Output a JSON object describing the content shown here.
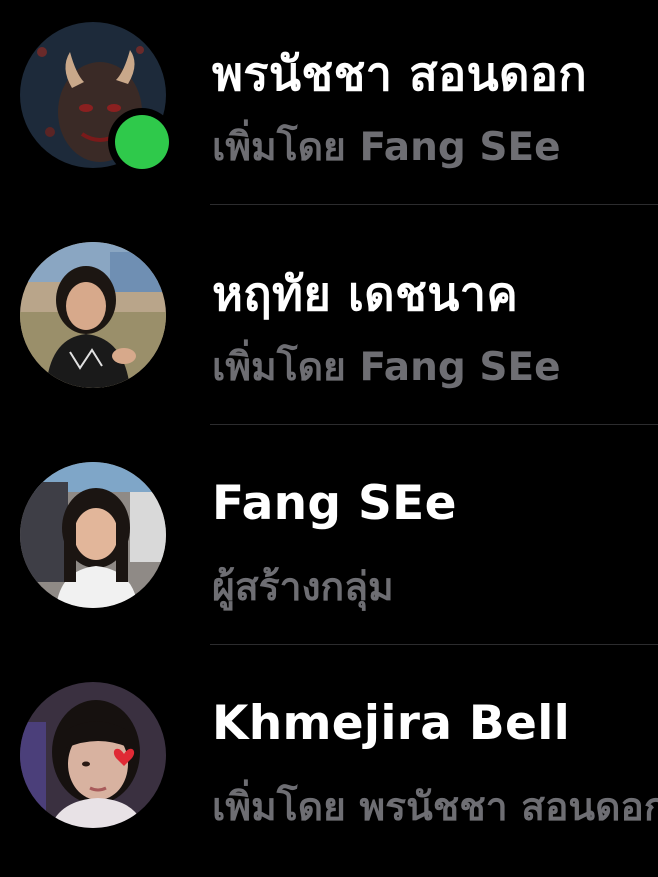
{
  "colors": {
    "background": "#000000",
    "name_text": "#ffffff",
    "subtitle_text": "#6e6e73",
    "online_indicator": "#2fc94b",
    "divider": "#2c2c2e"
  },
  "members": [
    {
      "name": "พรนัชชา สอนดอก",
      "subtitle": "เพิ่มโดย Fang SEe",
      "online": true,
      "avatar_icon": "profile-photo"
    },
    {
      "name": "หฤทัย เดชนาค",
      "subtitle": "เพิ่มโดย Fang SEe",
      "online": false,
      "avatar_icon": "profile-photo"
    },
    {
      "name": "Fang SEe",
      "subtitle": "ผู้สร้างกลุ่ม",
      "online": false,
      "avatar_icon": "profile-photo"
    },
    {
      "name": "Khmejira Bell",
      "subtitle": "เพิ่มโดย พรนัชชา สอนดอก",
      "online": false,
      "avatar_icon": "profile-photo"
    }
  ]
}
